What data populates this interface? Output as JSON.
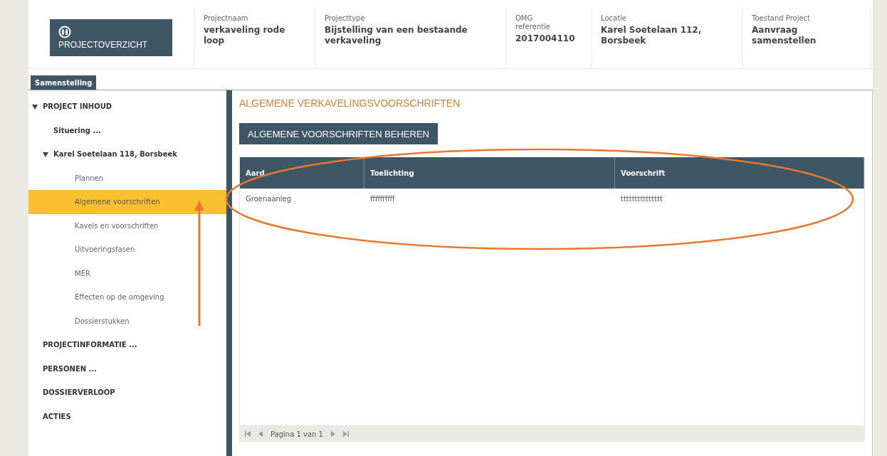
{
  "header": {
    "home_button": {
      "label": "PROJECTOVERZICHT"
    },
    "fields": [
      {
        "label": "Projectnaam",
        "value": "verkaveling rode loop"
      },
      {
        "label": "Projecttype",
        "value": "Bijstelling van een bestaande verkaveling"
      },
      {
        "label": "OMG referentie",
        "value": "2017004110"
      },
      {
        "label": "Locatie",
        "value": "Karel Soetelaan 112, Borsbeek"
      },
      {
        "label": "Toestand Project",
        "value": "Aanvraag samenstellen"
      }
    ]
  },
  "tabs": [
    {
      "label": "Samenstelling",
      "selected": true
    }
  ],
  "sidebar": {
    "items": [
      {
        "label": "PROJECT INHOUD",
        "selected": false,
        "expanded": true,
        "children": [
          {
            "label": "Situering ...",
            "selected": false
          },
          {
            "label": "Karel Soetelaan 118, Borsbeek",
            "selected": false,
            "expanded": true,
            "children": [
              {
                "label": "Plannen",
                "selected": false
              },
              {
                "label": "Algemene voorschriften",
                "selected": true
              },
              {
                "label": "Kavels en voorschriften",
                "selected": false
              },
              {
                "label": "Uitvoeringsfasen",
                "selected": false
              },
              {
                "label": "MER",
                "selected": false
              },
              {
                "label": "Effecten op de omgeving",
                "selected": false
              },
              {
                "label": "Dossierstukken",
                "selected": false
              }
            ]
          }
        ]
      },
      {
        "label": "PROJECTINFORMATIE ...",
        "selected": false
      },
      {
        "label": "PERSONEN ...",
        "selected": false
      },
      {
        "label": "DOSSIERVERLOOP",
        "selected": false
      },
      {
        "label": "ACTIES",
        "selected": false
      }
    ]
  },
  "content": {
    "title": "ALGEMENE VERKAVELINGSVOORSCHRIFTEN",
    "button": "ALGEMENE VOORSCHRIFTEN BEHEREN",
    "table": {
      "columns": [
        "Aard",
        "Toelichting",
        "Voorschrift"
      ],
      "rows": [
        [
          "Groenaanleg",
          "ffffffffff",
          "ttttttttttttttt"
        ]
      ]
    },
    "pager": {
      "text": "Pagina 1 van 1"
    }
  }
}
